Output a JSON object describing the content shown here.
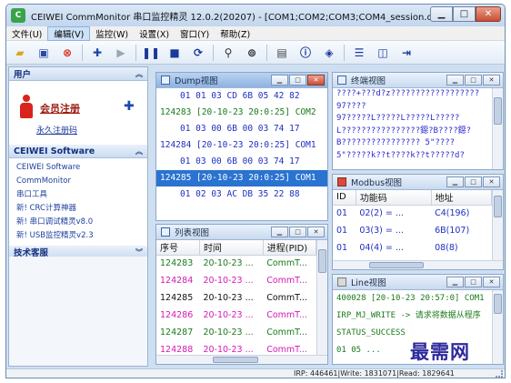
{
  "window": {
    "title": "CEIWEI CommMonitor 串口监控精灵 12.0.2(20207) - [COM1;COM2;COM3;COM4_session.cpm]",
    "min_icon": "minimize-icon",
    "max_icon": "maximize-icon",
    "close_icon": "close-icon"
  },
  "menu": [
    "文件(U)",
    "编辑(V)",
    "监控(W)",
    "设置(X)",
    "窗口(Y)",
    "帮助(Z)"
  ],
  "toolbar": {
    "icons": [
      "open-folder-icon",
      "save-icon",
      "stop-red-icon",
      "add-icon",
      "play-icon",
      "pause-icon",
      "stop-icon",
      "refresh-icon",
      "filter-icon",
      "find-icon",
      "page-icon",
      "info-icon",
      "layers-icon",
      "layout-horizontal-icon",
      "layout-vertical-icon",
      "exit-icon"
    ]
  },
  "sidebar": {
    "user_header": "用户",
    "member_link": "会员注册",
    "register_link": "永久注册码",
    "software_header": "CEIWEI Software",
    "software_items": [
      "CEIWEI Software",
      "CommMonitor",
      "串口工具",
      "新! CRC计算神器",
      "新! 串口调试精灵v8.0",
      "新! USB监控精灵v2.3"
    ],
    "support_header": "技术客服"
  },
  "dump": {
    "title": "Dump视图",
    "rows": [
      {
        "text": "01 01 03 CD 6B 05 42 82",
        "style": "blue",
        "selected": false
      },
      {
        "text": "124283 [20-10-23 20:0:25] COM2",
        "style": "green",
        "selected": false
      },
      {
        "text": "01 03 00 6B 00 03 74 17",
        "style": "blue",
        "selected": false
      },
      {
        "text": "124284 [20-10-23 20:0:25] COM1",
        "style": "blue",
        "selected": false
      },
      {
        "text": "01 03 00 6B 00 03 74 17",
        "style": "blue",
        "selected": false
      },
      {
        "text": "124285 [20-10-23 20:0:25] COM1",
        "style": "blue",
        "selected": true
      },
      {
        "text": "01 02 03 AC DB 35 22 88",
        "style": "blue",
        "selected": false
      }
    ]
  },
  "terminal": {
    "title": "终端视图",
    "lines": [
      "????+???d?z??????????????????",
      "97????",
      "97?????L?????L?????L?????",
      "L????????????????鐚?B????鐚?",
      "B????????????????  5\"????",
      "  5\"?????k??t????k??t?????d?"
    ]
  },
  "modbus": {
    "title": "Modbus视图",
    "columns": [
      "ID",
      "功能码",
      "地址"
    ],
    "rows": [
      [
        "01",
        "02(2) = ...",
        "C4(196)"
      ],
      [
        "01",
        "03(3) = ...",
        "6B(107)"
      ],
      [
        "01",
        "04(4) = ...",
        "08(8)"
      ]
    ]
  },
  "list": {
    "title": "列表视图",
    "columns": [
      "序号",
      "时间",
      "进程(PID)"
    ],
    "rows": [
      {
        "cells": [
          "124283",
          "20-10-23 ...",
          "CommT..."
        ],
        "style": "green"
      },
      {
        "cells": [
          "124284",
          "20-10-23 ...",
          "CommT..."
        ],
        "style": "pink"
      },
      {
        "cells": [
          "124285",
          "20-10-23 ...",
          "CommT..."
        ],
        "style": "black"
      },
      {
        "cells": [
          "124286",
          "20-10-23 ...",
          "CommT..."
        ],
        "style": "pink"
      },
      {
        "cells": [
          "124287",
          "20-10-23 ...",
          "CommT..."
        ],
        "style": "green"
      },
      {
        "cells": [
          "124288",
          "20-10-23 ...",
          "CommT..."
        ],
        "style": "pink"
      }
    ]
  },
  "line": {
    "title": "Line视图",
    "lines": [
      "400028 [20-10-23 20:57:0] COM1",
      "IRP_MJ_WRITE -> 请求将数据从程序",
      "    STATUS_SUCCESS",
      "      01 05 ..."
    ]
  },
  "status": {
    "text": "IRP: 446461|Write: 1831071|Read: 1829641"
  },
  "watermark": "最需网",
  "colors": {
    "accent": "#2a73d0",
    "green_text": "#1a7a1a",
    "blue_text": "#1f2fc0",
    "pink_text": "#d418b4"
  }
}
